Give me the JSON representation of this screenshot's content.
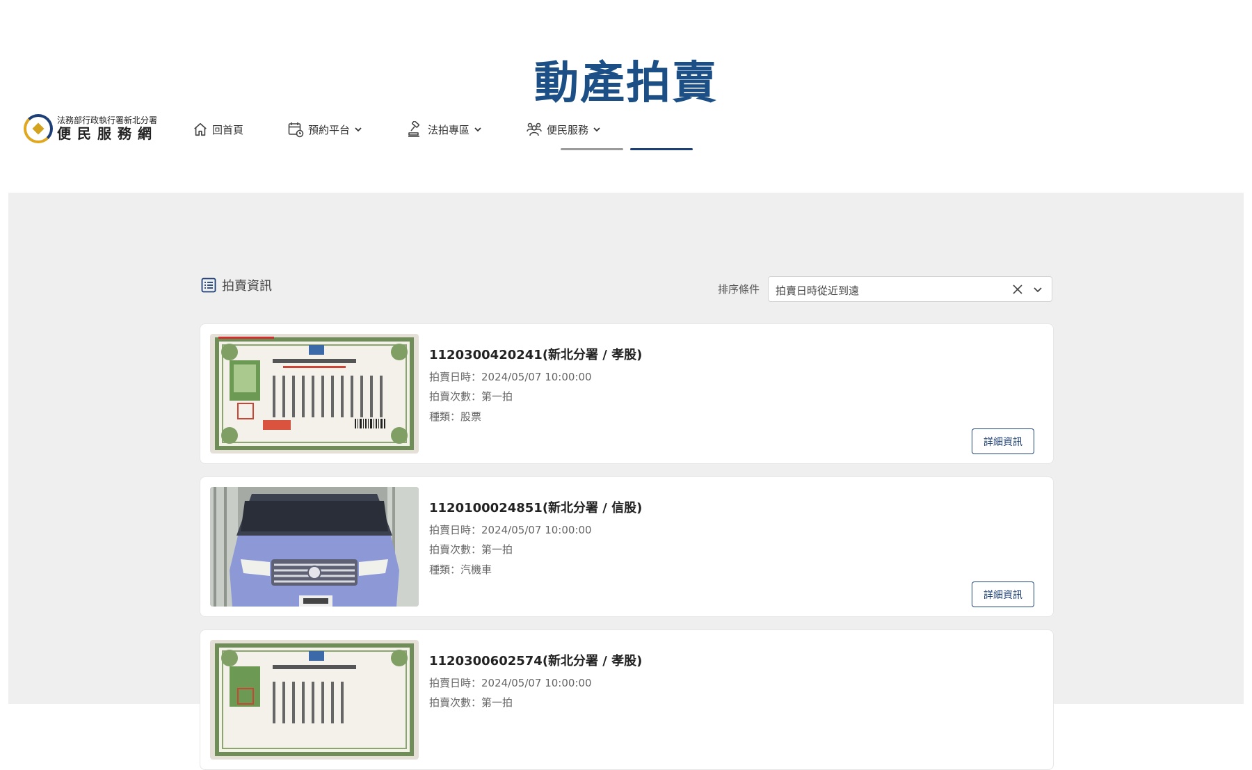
{
  "page_title": "動產拍賣",
  "logo": {
    "top_text": "法務部行政執行署新北分署",
    "main_text": "便民服務網"
  },
  "nav": {
    "items": [
      {
        "label": "回首頁",
        "icon": "home-icon",
        "has_dropdown": false
      },
      {
        "label": "預約平台",
        "icon": "calendar-icon",
        "has_dropdown": true
      },
      {
        "label": "法拍專區",
        "icon": "auction-gavel-icon",
        "has_dropdown": true
      },
      {
        "label": "便民服務",
        "icon": "people-icon",
        "has_dropdown": true
      }
    ],
    "indicator_colors": [
      "#9a9a9a",
      "#1d3f77"
    ]
  },
  "section": {
    "icon": "list-icon",
    "title": "拍賣資訊"
  },
  "sort": {
    "label": "排序條件",
    "value": "拍賣日時從近到遠",
    "clear_icon": "close-icon",
    "arrow_icon": "chevron-down-icon"
  },
  "listings": [
    {
      "title": "1120300420241(新北分署 / 孝股)",
      "date": "拍賣日時：2024/05/07 10:00:00",
      "round": "拍賣次數：第一拍",
      "category": "種類：股票",
      "image": "stock-certificate-image",
      "button": "詳細資訊"
    },
    {
      "title": "1120100024851(新北分署 / 信股)",
      "date": "拍賣日時：2024/05/07 10:00:00",
      "round": "拍賣次數：第一拍",
      "category": "種類：汽機車",
      "image": "blue-car-image",
      "button": "詳細資訊"
    },
    {
      "title": "1120300602574(新北分署 / 孝股)",
      "date": "拍賣日時：2024/05/07 10:00:00",
      "round": "拍賣次數：第一拍",
      "category": "",
      "image": "stock-certificate-image",
      "button": ""
    }
  ],
  "colors": {
    "title": "#1b4f86",
    "brand": "#1d3f77",
    "content_background": "#efefef"
  }
}
